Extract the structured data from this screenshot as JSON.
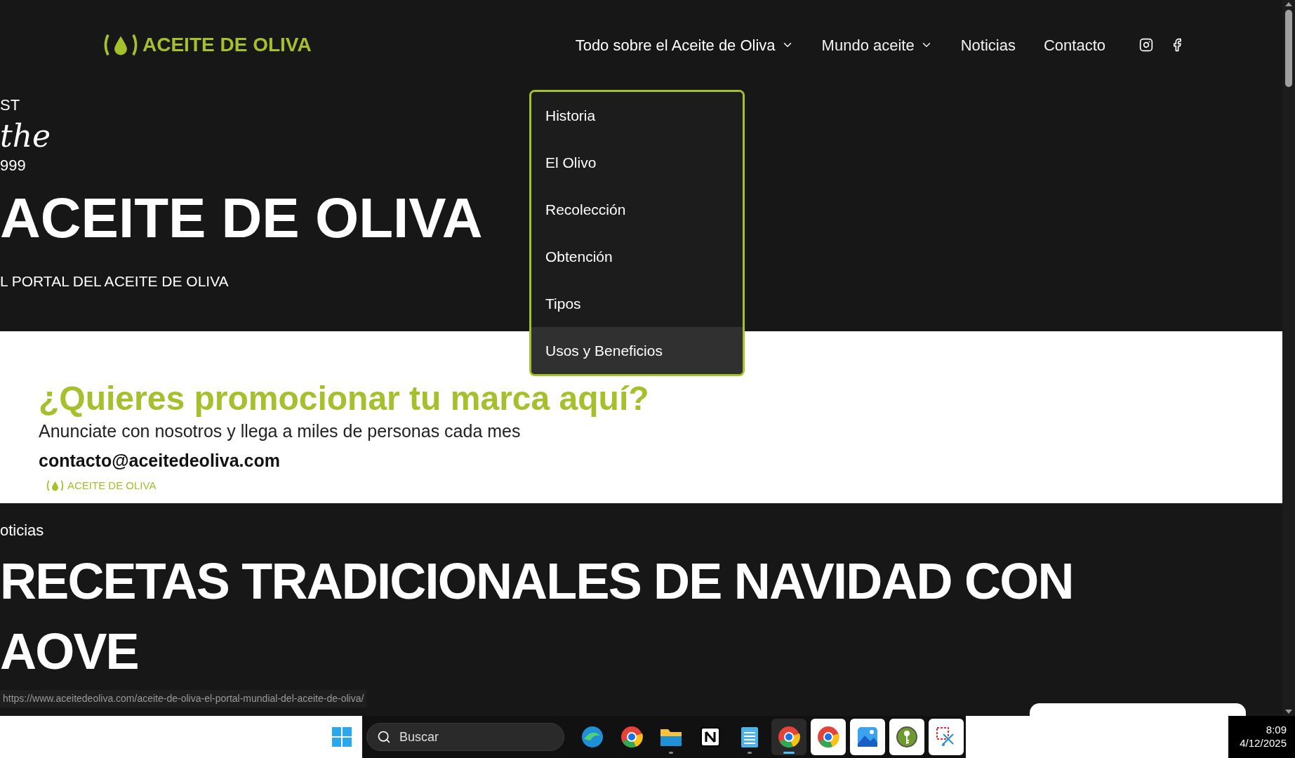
{
  "header": {
    "logo": "ACEITE DE OLIVA",
    "nav": [
      {
        "label": "Todo sobre el Aceite de Oliva",
        "dropdown": true,
        "expanded": true
      },
      {
        "label": "Mundo aceite",
        "dropdown": true,
        "expanded": false
      },
      {
        "label": "Noticias",
        "dropdown": false,
        "expanded": false
      },
      {
        "label": "Contacto",
        "dropdown": false,
        "expanded": false
      }
    ]
  },
  "dropdown": {
    "items": [
      {
        "label": "Historia",
        "selected": false
      },
      {
        "label": "El Olivo",
        "selected": false
      },
      {
        "label": "Recolección",
        "selected": false
      },
      {
        "label": "Obtención",
        "selected": false
      },
      {
        "label": "Tipos",
        "selected": false
      },
      {
        "label": "Usos y Beneficios",
        "selected": true
      }
    ]
  },
  "hero": {
    "eyebrow": "ST",
    "script": "the",
    "year": "999",
    "title": "ACEITE DE OLIVA",
    "subtitle": "L PORTAL DEL ACEITE DE OLIVA"
  },
  "ad": {
    "headline": "¿Quieres promocionar tu marca aquí?",
    "text": "Anunciate con nosotros y llega a miles de personas cada mes",
    "email": "contacto@aceitedeoliva.com",
    "logo": "ACEITE DE OLIVA"
  },
  "news": {
    "category": "oticias",
    "headline": "RECETAS TRADICIONALES DE NAVIDAD CON AOVE"
  },
  "status_url": "https://www.aceitedeoliva.com/aceite-de-oliva-el-portal-mundial-del-aceite-de-oliva/",
  "taskbar": {
    "search_placeholder": "Buscar",
    "apps": [
      {
        "kind": "edge",
        "running": false,
        "selected": false
      },
      {
        "kind": "chrome",
        "running": false,
        "selected": false
      },
      {
        "kind": "folder",
        "running": true,
        "selected": false
      },
      {
        "kind": "notion",
        "running": false,
        "selected": false
      },
      {
        "kind": "notepad",
        "running": true,
        "selected": false
      },
      {
        "kind": "chrome",
        "running": true,
        "selected": true
      },
      {
        "kind": "chrome",
        "running": false,
        "selected": false
      },
      {
        "kind": "photos",
        "running": false,
        "selected": false
      },
      {
        "kind": "key",
        "running": false,
        "selected": false
      },
      {
        "kind": "snip",
        "running": false,
        "selected": false
      }
    ],
    "time": "8:09",
    "date": "4/12/2025"
  }
}
